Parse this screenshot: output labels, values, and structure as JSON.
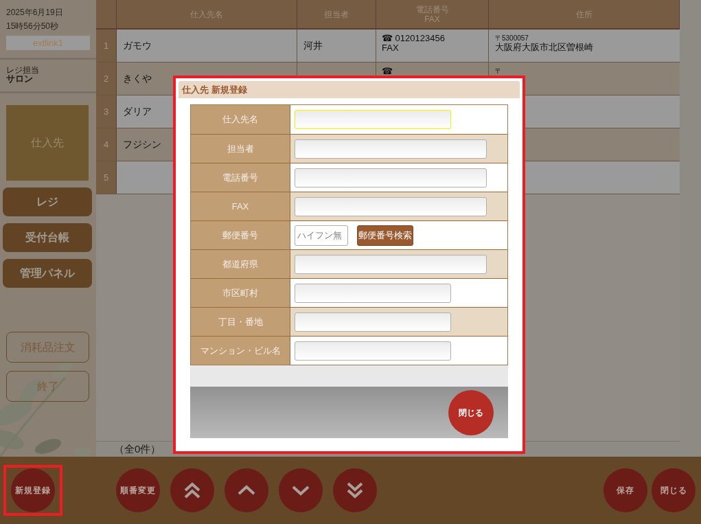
{
  "sidebar": {
    "date": "2025年6月19日",
    "time": "15時56分50秒",
    "link": "extlink1",
    "staff_label": "レジ担当",
    "staff_name": "サロン",
    "tile": "仕入先",
    "nav": [
      {
        "label": "レジ",
        "kind": "filled"
      },
      {
        "label": "受付台帳",
        "kind": "filled"
      },
      {
        "label": "管理パネル",
        "kind": "filled"
      },
      {
        "label": "消耗品注文",
        "kind": "outline"
      },
      {
        "label": "終了",
        "kind": "outline"
      }
    ]
  },
  "table": {
    "columns": [
      "仕入先名",
      "担当者",
      "電話番号\nFAX",
      "住所"
    ],
    "rows": [
      {
        "no": "1",
        "name": "ガモウ",
        "staff": "河井",
        "phone": "☎ 0120123456",
        "fax": "FAX",
        "postal": "〒5300057",
        "address": "大阪府大阪市北区曽根崎"
      },
      {
        "no": "2",
        "name": "きくや",
        "staff": "",
        "phone": "☎",
        "fax": "",
        "postal": "〒",
        "address": ""
      },
      {
        "no": "3",
        "name": "ダリア",
        "staff": "",
        "phone": "",
        "fax": "",
        "postal": "",
        "address": ""
      },
      {
        "no": "4",
        "name": "フジシン",
        "staff": "",
        "phone": "",
        "fax": "",
        "postal": "",
        "address": ""
      },
      {
        "no": "5",
        "name": "",
        "staff": "",
        "phone": "",
        "fax": "",
        "postal": "",
        "address": ""
      }
    ],
    "count": "（全0件）"
  },
  "modal": {
    "title": "仕入先 新規登録",
    "fields": [
      {
        "label": "仕入先名",
        "kind": "text",
        "wide": false,
        "focused": true
      },
      {
        "label": "担当者",
        "kind": "text",
        "wide": true,
        "focused": false
      },
      {
        "label": "電話番号",
        "kind": "text",
        "wide": true,
        "focused": false
      },
      {
        "label": "FAX",
        "kind": "text",
        "wide": true,
        "focused": false
      },
      {
        "label": "郵便番号",
        "kind": "postal",
        "placeholder": "ハイフン無",
        "button": "郵便番号検索",
        "focused": false
      },
      {
        "label": "都道府県",
        "kind": "text",
        "wide": true,
        "focused": false
      },
      {
        "label": "市区町村",
        "kind": "text",
        "wide": false,
        "focused": false
      },
      {
        "label": "丁目・番地",
        "kind": "text",
        "wide": false,
        "focused": false
      },
      {
        "label": "マンション・ビル名",
        "kind": "text",
        "wide": false,
        "focused": false
      }
    ],
    "close": "閉じる"
  },
  "toolbar": [
    {
      "kind": "text",
      "label": "新規登録",
      "highlighted": true
    },
    {
      "kind": "text",
      "label": "順番変更",
      "highlighted": false
    },
    {
      "kind": "top",
      "highlighted": false
    },
    {
      "kind": "up",
      "highlighted": false
    },
    {
      "kind": "down",
      "highlighted": false
    },
    {
      "kind": "bottom",
      "highlighted": false
    },
    {
      "kind": "spacer"
    },
    {
      "kind": "text",
      "label": "保存",
      "highlighted": false
    },
    {
      "kind": "text",
      "label": "閉じる",
      "highlighted": false
    }
  ]
}
